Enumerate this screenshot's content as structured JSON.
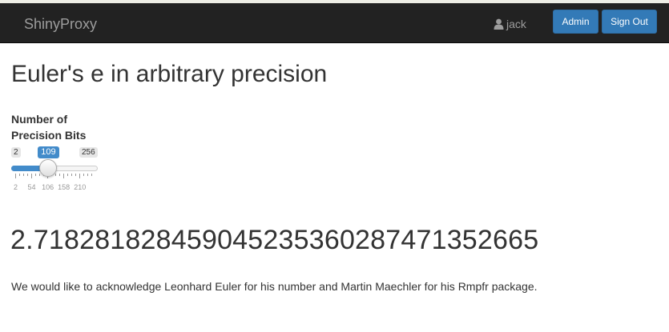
{
  "navbar": {
    "brand": "ShinyProxy",
    "user_name": "jack",
    "user_icon": "user-icon",
    "admin_label": "Admin",
    "signout_label": "Sign Out"
  },
  "main": {
    "title": "Euler's e in arbitrary precision",
    "slider": {
      "label": "Number of Precision Bits",
      "min": 2,
      "max": 256,
      "value": 109,
      "min_label": "2",
      "max_label": "256",
      "value_label": "109",
      "tick_labels": [
        "2",
        "54",
        "106",
        "158",
        "210"
      ]
    },
    "result": "2.718281828459045235360287471352665",
    "acknowledgement": "We would like to acknowledge Leonhard Euler for his number and Martin Maechler for his Rmpfr package."
  },
  "colors": {
    "navbar_bg": "#222222",
    "button_primary": "#337ab7",
    "slider_fill": "#428bca"
  }
}
